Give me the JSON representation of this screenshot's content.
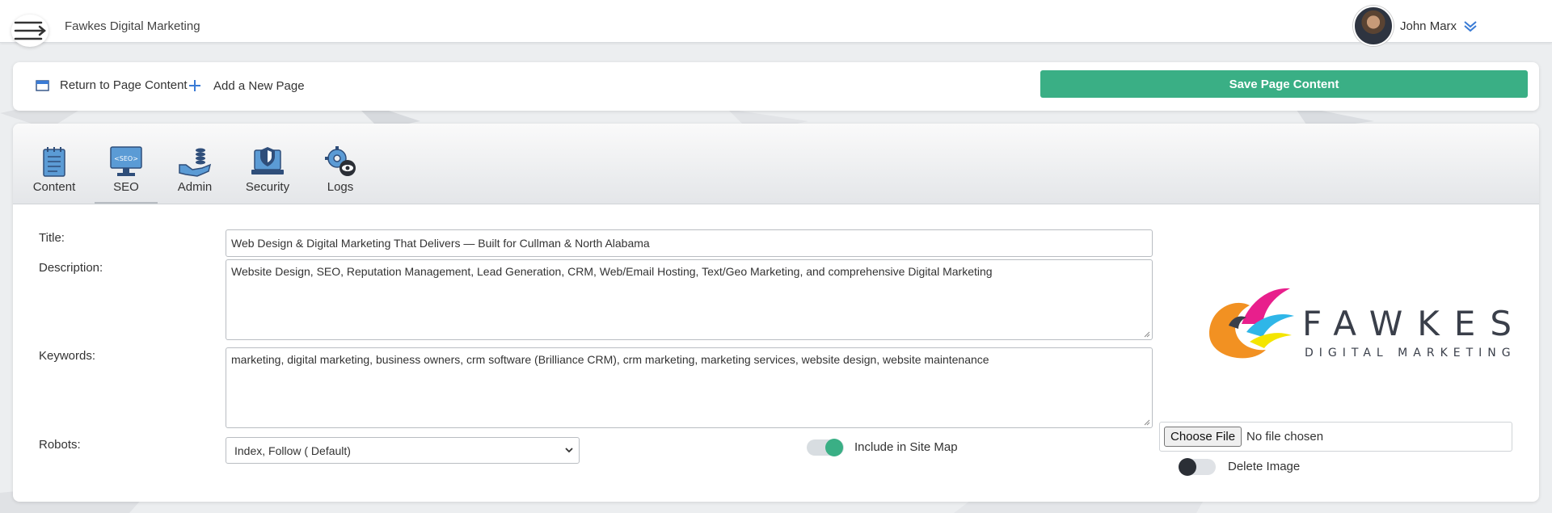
{
  "header": {
    "brand": "Fawkes Digital Marketing",
    "user_name": "John Marx"
  },
  "toolbar": {
    "return_label": "Return to Page Content",
    "add_label": "Add a New Page",
    "save_label": "Save Page Content"
  },
  "tabs": [
    {
      "label": "Content",
      "icon": "notepad-icon"
    },
    {
      "label": "SEO",
      "icon": "seo-monitor-icon",
      "active": true
    },
    {
      "label": "Admin",
      "icon": "admin-hand-coins-icon"
    },
    {
      "label": "Security",
      "icon": "security-laptop-shield-icon"
    },
    {
      "label": "Logs",
      "icon": "logs-gear-eye-icon"
    }
  ],
  "form": {
    "title_label": "Title:",
    "title_value": "Web Design & Digital Marketing That Delivers — Built for Cullman & North Alabama",
    "description_label": "Description:",
    "description_value": "Website Design, SEO, Reputation Management, Lead Generation, CRM, Web/Email Hosting, Text/Geo Marketing, and comprehensive Digital Marketing",
    "keywords_label": "Keywords:",
    "keywords_value": "marketing, digital marketing, business owners, crm software (Brilliance CRM), crm marketing, marketing services, website design, website maintenance",
    "robots_label": "Robots:",
    "robots_value": "Index, Follow ( Default)",
    "sitemap_label": "Include in Site Map",
    "sitemap_on": true
  },
  "image": {
    "logo_word": "FAWKES",
    "logo_sub": "DIGITAL MARKETING",
    "choose_label": "Choose File",
    "file_status": "No file chosen",
    "delete_label": "Delete Image",
    "delete_on": false
  },
  "colors": {
    "accent": "#3aaf85"
  }
}
